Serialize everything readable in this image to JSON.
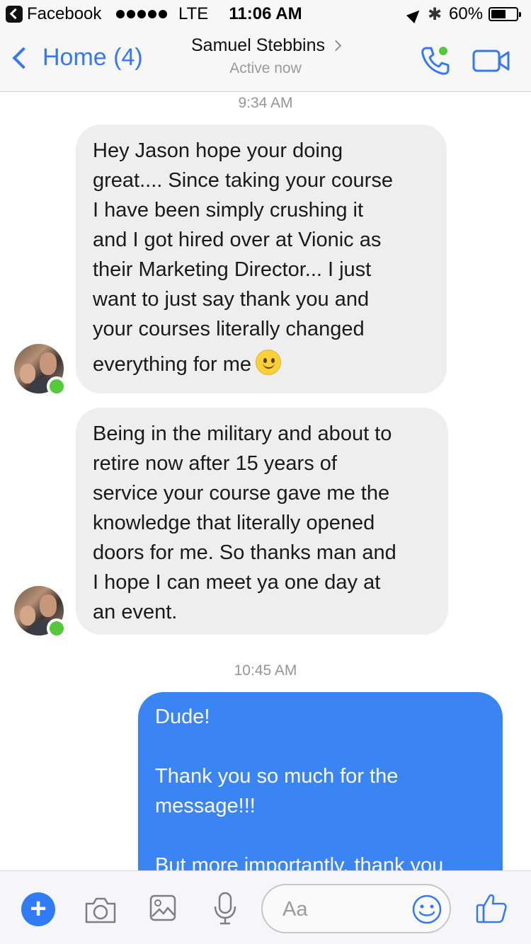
{
  "status_bar": {
    "back_app": "Facebook",
    "network": "LTE",
    "time": "11:06 AM",
    "battery": "60%",
    "battery_level": 0.6
  },
  "nav": {
    "back_label": "Home (4)",
    "contact_name": "Samuel Stebbins",
    "contact_status": "Active now",
    "icons": [
      "phone-icon",
      "video-camera-icon"
    ],
    "accent_color": "#3478f6",
    "presence_color": "#54c93b"
  },
  "chat": {
    "timestamps": [
      "9:34 AM",
      "10:45 AM"
    ],
    "incoming": [
      {
        "lines": [
          "Hey Jason hope your doing",
          "great.... Since taking your course",
          "I have been simply crushing it",
          "and I got hired over at Vionic as",
          "their Marketing Director... I just",
          "want to just say thank you and",
          "your courses literally changed",
          "everything for me"
        ],
        "emoji": "slightly-smiling-face-emoji"
      },
      {
        "lines": [
          "Being in the military and about to",
          "retire now after 15 years of",
          "service your course gave me the",
          "knowledge that literally opened",
          "doors for me. So thanks man and",
          "I hope I can meet ya one day at",
          "an event."
        ]
      }
    ],
    "outgoing": {
      "lines": [
        "Dude!",
        "",
        "Thank you so much for the",
        "message!!!",
        "",
        "But more importantly, thank you"
      ],
      "color": "#3a84f3"
    }
  },
  "composer": {
    "placeholder": "Aa",
    "icons": [
      "plus-icon",
      "camera-icon",
      "photo-icon",
      "microphone-icon",
      "emoji-icon",
      "thumbs-up-icon"
    ]
  }
}
